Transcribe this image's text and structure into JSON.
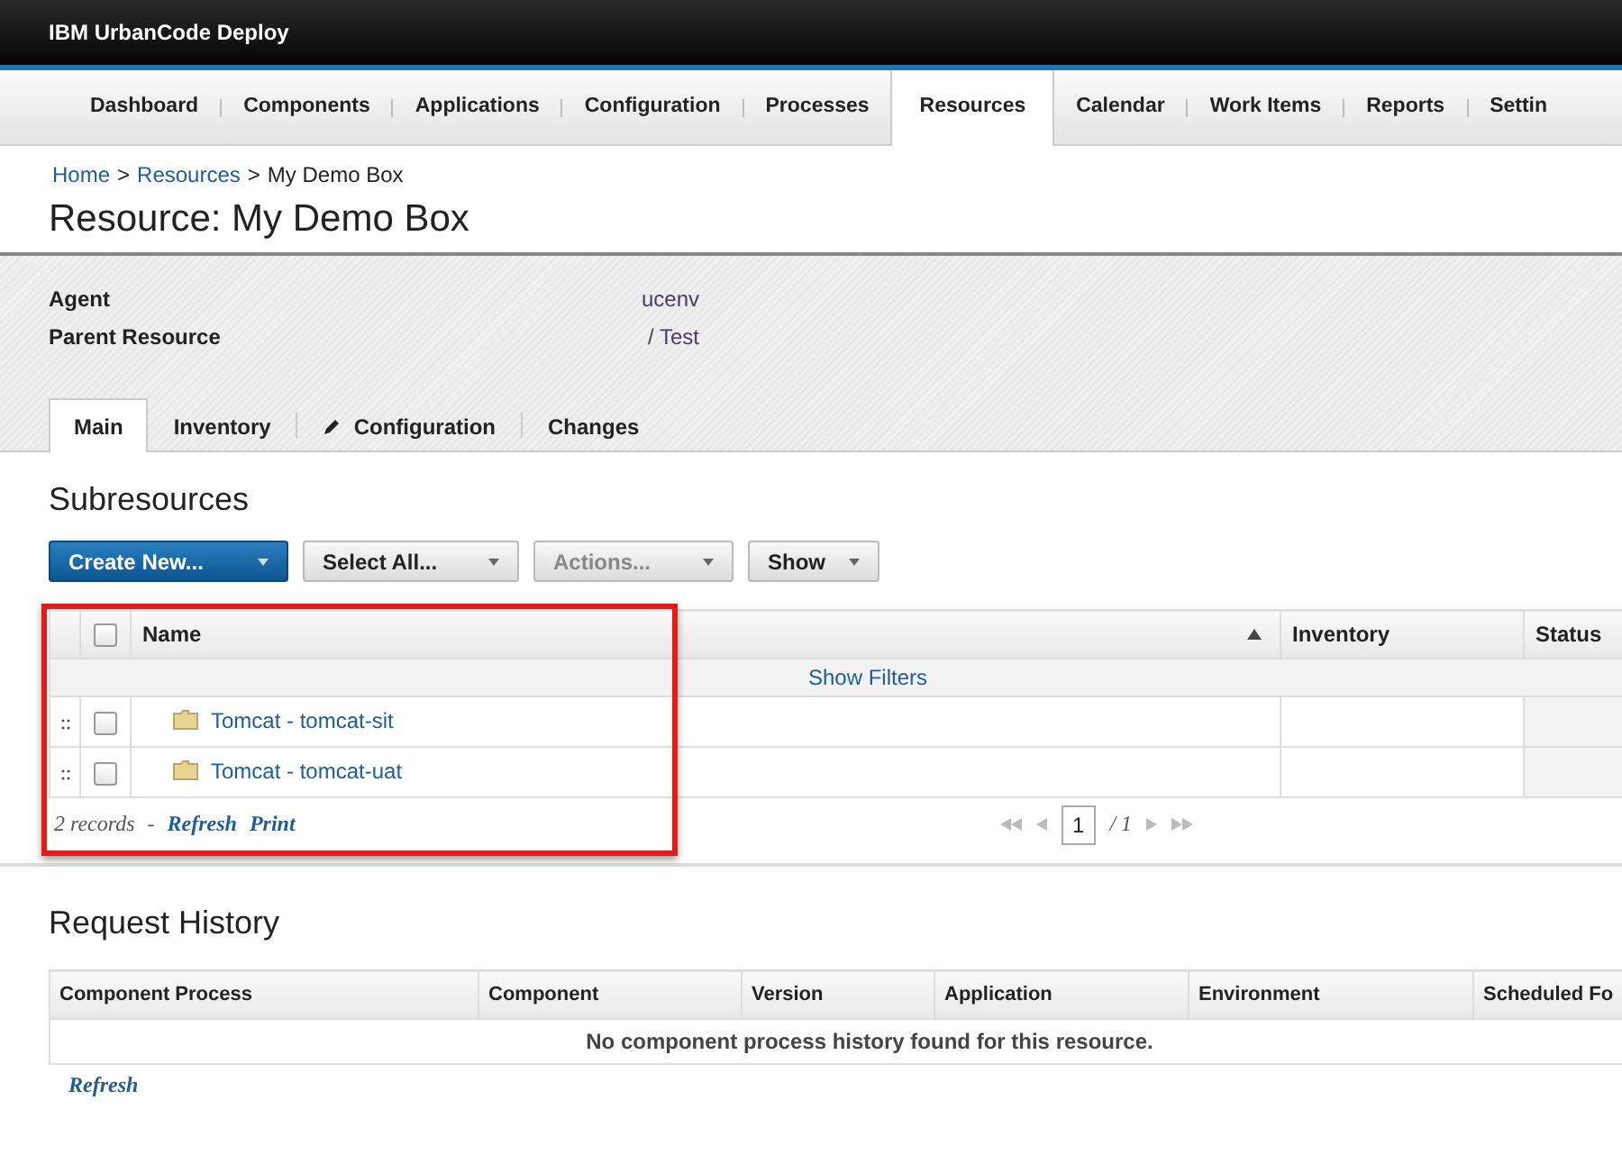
{
  "app_title": "IBM UrbanCode Deploy",
  "nav": [
    {
      "label": "Dashboard",
      "selected": false
    },
    {
      "label": "Components",
      "selected": false
    },
    {
      "label": "Applications",
      "selected": false
    },
    {
      "label": "Configuration",
      "selected": false
    },
    {
      "label": "Processes",
      "selected": false
    },
    {
      "label": "Resources",
      "selected": true
    },
    {
      "label": "Calendar",
      "selected": false
    },
    {
      "label": "Work Items",
      "selected": false
    },
    {
      "label": "Reports",
      "selected": false
    },
    {
      "label": "Settin",
      "selected": false
    }
  ],
  "breadcrumb": [
    {
      "label": "Home",
      "link": true
    },
    {
      "label": "Resources",
      "link": true
    },
    {
      "label": "My Demo Box",
      "link": false
    }
  ],
  "breadcrumb_separator": ">",
  "page_title": "Resource: My Demo Box",
  "properties": [
    {
      "label": "Agent",
      "value": "ucenv"
    },
    {
      "label": "Parent Resource",
      "value": "/ Test"
    }
  ],
  "tabs": [
    {
      "label": "Main",
      "selected": true,
      "icon": false
    },
    {
      "label": "Inventory",
      "selected": false,
      "icon": false
    },
    {
      "label": "Configuration",
      "selected": false,
      "icon": true
    },
    {
      "label": "Changes",
      "selected": false,
      "icon": false
    }
  ],
  "subresources": {
    "title": "Subresources",
    "buttons": [
      {
        "label": "Create New...",
        "kind": "primary"
      },
      {
        "label": "Select All...",
        "kind": "normal"
      },
      {
        "label": "Actions...",
        "kind": "disabled"
      },
      {
        "label": "Show",
        "kind": "normal"
      }
    ],
    "select_all_checked": false,
    "columns": [
      "Name",
      "Inventory",
      "Status"
    ],
    "show_filters": "Show Filters",
    "rows": [
      {
        "name": "Tomcat - tomcat-sit",
        "checked": false
      },
      {
        "name": "Tomcat - tomcat-uat",
        "checked": false
      }
    ],
    "record_count": "2 records",
    "footer_separator": "-",
    "footer_links": [
      "Refresh",
      "Print"
    ],
    "page": "1",
    "page_total": "/ 1"
  },
  "request_history": {
    "title": "Request History",
    "columns": [
      "Component Process",
      "Component",
      "Version",
      "Application",
      "Environment",
      "Scheduled Fo"
    ],
    "empty_message": "No component process history found for this resource.",
    "refresh": "Refresh"
  }
}
